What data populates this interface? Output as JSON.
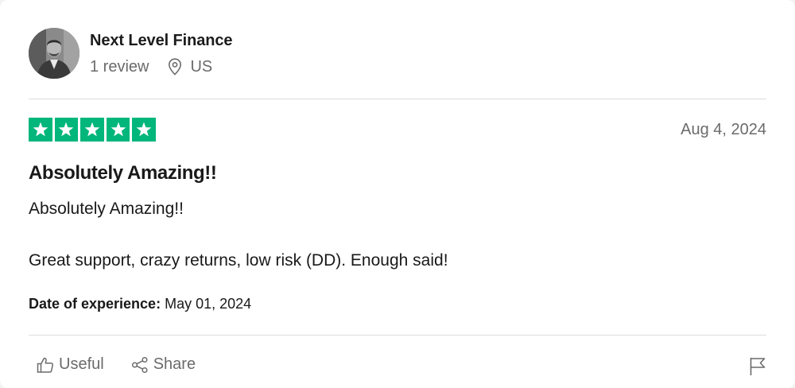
{
  "consumer": {
    "name": "Next Level Finance",
    "review_count": "1 review",
    "country": "US",
    "avatar_icon": "profile-photo"
  },
  "review": {
    "rating": 5,
    "rating_max": 5,
    "star_color": "#00b67a",
    "date": "Aug 4, 2024",
    "title": "Absolutely Amazing!!",
    "body": [
      "Absolutely Amazing!!",
      "Great support, crazy returns, low risk (DD). Enough said!"
    ],
    "experience_label": "Date of experience:",
    "experience_date": "May 01, 2024"
  },
  "actions": {
    "useful_label": "Useful",
    "share_label": "Share",
    "useful_icon": "thumbs-up-icon",
    "share_icon": "share-icon",
    "report_icon": "flag-icon"
  }
}
